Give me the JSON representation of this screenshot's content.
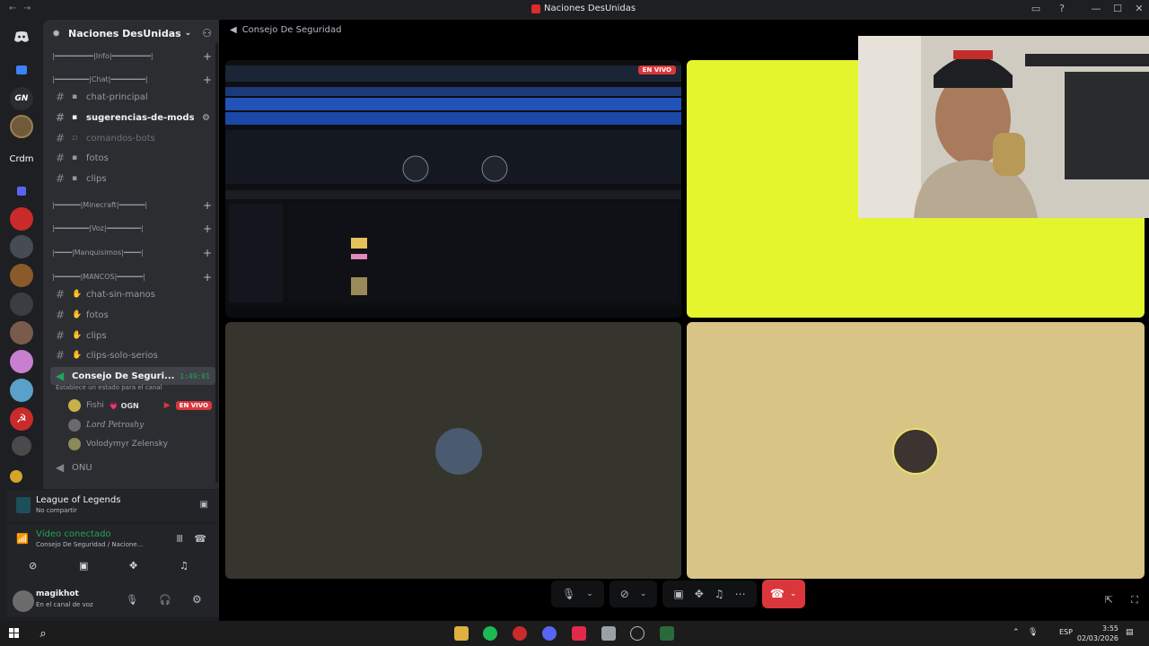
{
  "window": {
    "title": "Naciones DesUnidas",
    "nav_back": "←",
    "nav_forward": "→",
    "controls": [
      "▭",
      "?",
      "—",
      "☐",
      "✕"
    ]
  },
  "servers": [
    {
      "name": "discord-home",
      "label": "",
      "color": "#1e1f22"
    },
    {
      "name": "folder-blue",
      "label": "",
      "color": "#3b6fd4"
    },
    {
      "name": "server-gn",
      "label": "GN",
      "color": "#2b2d31"
    },
    {
      "name": "server-shield",
      "label": "",
      "color": "#6f5a3a"
    },
    {
      "name": "server-crdm",
      "label": "Crdm",
      "color": "#1e1f22"
    },
    {
      "name": "folder-blue-2",
      "label": "",
      "color": "#3b6fd4"
    },
    {
      "name": "server-red",
      "label": "",
      "color": "#c92b2b"
    },
    {
      "name": "server-grey",
      "label": "",
      "color": "#474c54"
    },
    {
      "name": "server-game",
      "label": "",
      "color": "#8a5a2b"
    },
    {
      "name": "server-dark",
      "label": "",
      "color": "#3a3d42"
    },
    {
      "name": "server-landscape",
      "label": "",
      "color": "#7a5a4a"
    },
    {
      "name": "server-anime",
      "label": "",
      "color": "#c97fd0"
    },
    {
      "name": "server-meme",
      "label": "",
      "color": "#5aa0c8"
    },
    {
      "name": "server-hammer",
      "label": "☭",
      "color": "#c92b2b"
    },
    {
      "name": "server-small",
      "label": "",
      "color": "#4a4a4a"
    }
  ],
  "guild": {
    "name": "Naciones DesUnidas",
    "categories": {
      "info": "|━━━━━━━━━|Info|━━━━━━━━━|",
      "chat": "|━━━━━━━━|Chat|━━━━━━━━|",
      "minecraft": "|━━━━━━|Minecraft|━━━━━━|",
      "voz": "|━━━━━━━━|Voz|━━━━━━━━|",
      "manquisimos": "|━━━━|Manquisimos|━━━━|",
      "mancos": "|━━━━━━|MANCOS|━━━━━━|"
    },
    "channels": {
      "chat_principal": "chat-principal",
      "sugerencias": "sugerencias-de-mods",
      "comandos": "comandos-bots",
      "fotos": "fotos",
      "clips": "clips",
      "chat_sin_manos": "chat-sin-manos",
      "fotos2": "fotos",
      "clips2": "clips",
      "clips_solo_serios": "clips-solo-serios",
      "consejo": "Consejo De Seguri...",
      "consejo_time": "1:49:01",
      "consejo_status": "Establece un estado para el canal",
      "onu": "ONU"
    },
    "voice_users": [
      {
        "name": "Fishi",
        "tag": "💗 OGN",
        "live": "EN VIVO",
        "color": "#c8b04a"
      },
      {
        "name": "Lord Petroshy",
        "tag": "",
        "live": "",
        "color": "#6a6a6a"
      },
      {
        "name": "Volodymyr Zelensky",
        "tag": "",
        "live": "",
        "color": "#8a8a5a"
      }
    ]
  },
  "activity": {
    "game": "League of Legends",
    "status": "No compartir"
  },
  "voice_connection": {
    "title": "Vídeo conectado",
    "channel": "Consejo De Seguridad / Nacione..."
  },
  "user": {
    "name": "magikhot",
    "status": "En el canal de voz"
  },
  "stage": {
    "header": "Consejo De Seguridad",
    "live_label": "EN VIVO"
  },
  "taskbar": {
    "time": "3:55",
    "date": "02/03/2026",
    "lang": "ESP"
  }
}
